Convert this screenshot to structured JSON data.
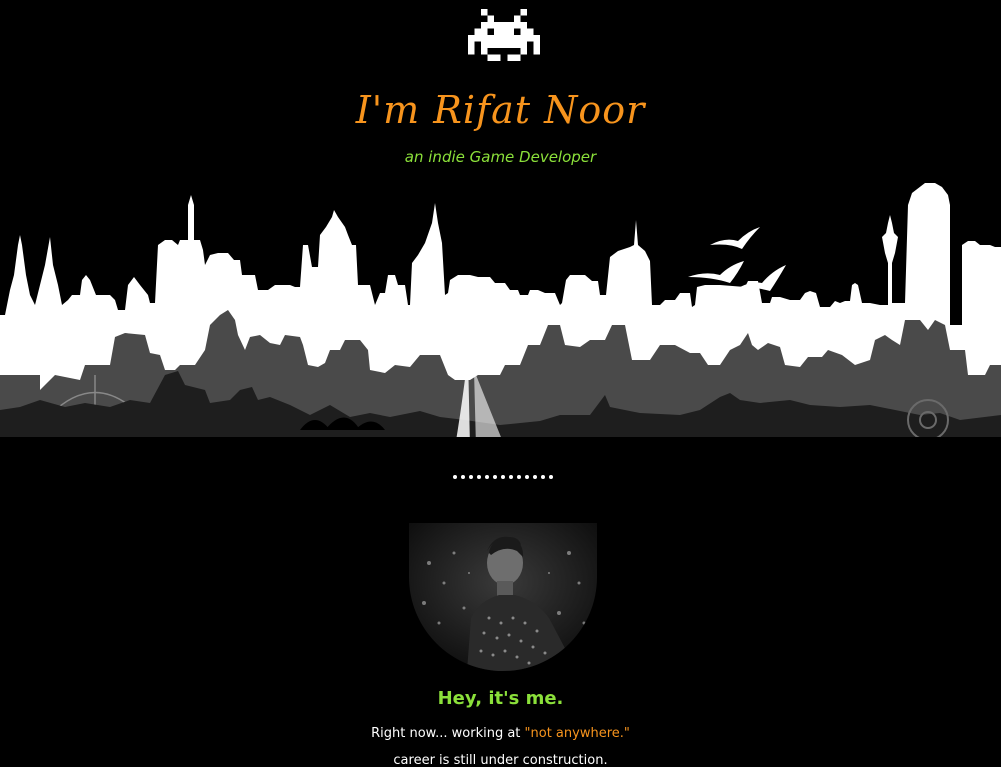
{
  "header": {
    "logo_icon": "space-invader-icon",
    "title": "I'm Rifat Noor",
    "subtitle": "an indie Game Developer"
  },
  "skyline": {
    "icon": "city-skyline-illustration"
  },
  "divider": {
    "icon": "dotted-divider"
  },
  "profile": {
    "avatar_icon": "profile-photo",
    "greeting": "Hey, it's me.",
    "status_prefix": "Right now... working at ",
    "status_highlight": "\"not anywhere.\"",
    "status_line2": "career is still under construction."
  },
  "colors": {
    "background": "#000000",
    "accent_orange": "#f7941d",
    "accent_green": "#8be03a",
    "text": "#ffffff"
  }
}
